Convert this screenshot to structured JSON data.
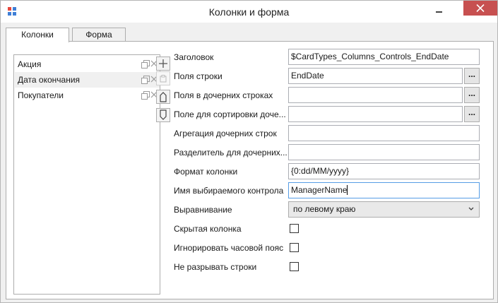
{
  "window": {
    "title": "Колонки и форма",
    "icon_colors": [
      "#e8473c",
      "#3f7fd6",
      "#3f7fd6",
      "#3f7fd6"
    ]
  },
  "tabs": [
    {
      "label": "Колонки",
      "active": true
    },
    {
      "label": "Форма",
      "active": false
    }
  ],
  "columns_list": {
    "items": [
      {
        "label": "Акция",
        "selected": false
      },
      {
        "label": "Дата окончания",
        "selected": true
      },
      {
        "label": "Покупатели",
        "selected": false
      }
    ]
  },
  "side_buttons": [
    "add-icon",
    "paste-icon",
    "move-up-icon",
    "move-down-icon"
  ],
  "form": {
    "header": {
      "label": "Заголовок",
      "value": "$CardTypes_Columns_Controls_EndDate"
    },
    "row_fields": {
      "label": "Поля строки",
      "value": "EndDate",
      "button": "..."
    },
    "child_row_fields": {
      "label": "Поля в дочерних строках",
      "value": "",
      "button": "..."
    },
    "child_sort_field": {
      "label": "Поле для сортировки доче...",
      "value": "",
      "button": "..."
    },
    "child_aggregation": {
      "label": "Агрегация дочерних строк",
      "value": ""
    },
    "child_separator": {
      "label": "Разделитель для дочерних...",
      "value": ""
    },
    "column_format": {
      "label": "Формат колонки",
      "value": "{0:dd/MM/yyyy}"
    },
    "selected_control": {
      "label": "Имя выбираемого контрола",
      "value": "ManagerName"
    },
    "alignment": {
      "label": "Выравнивание",
      "value": "по левому краю"
    },
    "hidden_column": {
      "label": "Скрытая колонка",
      "checked": false
    },
    "ignore_timezone": {
      "label": "Игнорировать часовой пояс",
      "checked": false
    },
    "no_wrap": {
      "label": "Не разрывать строки",
      "checked": false
    }
  }
}
